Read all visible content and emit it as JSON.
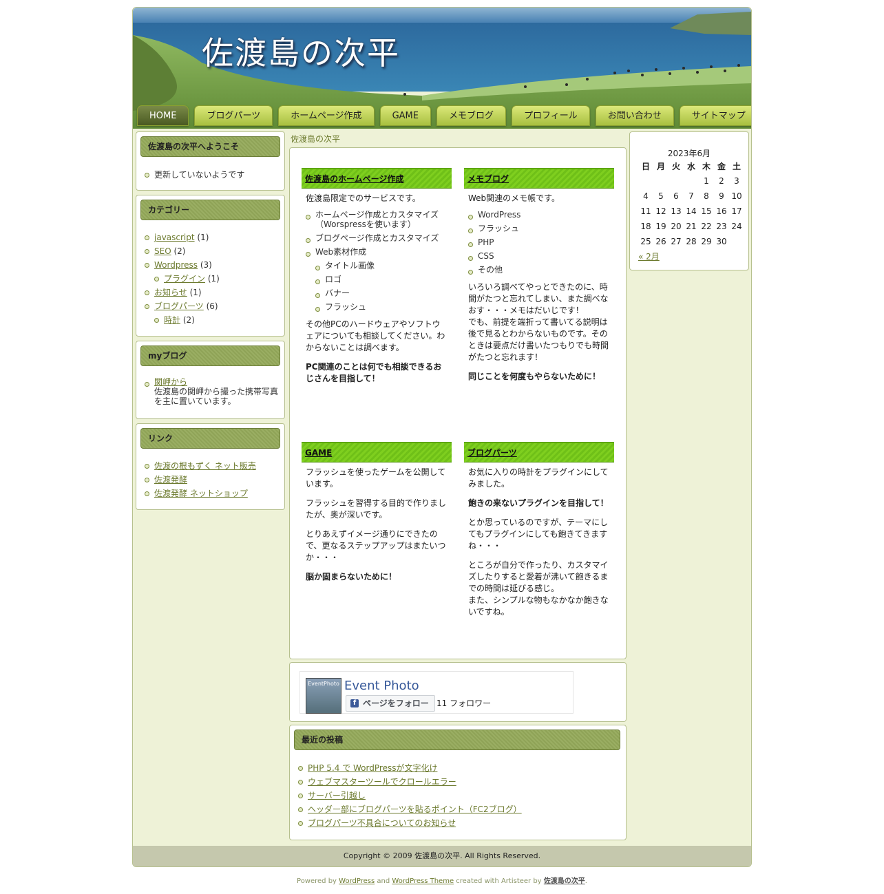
{
  "header": {
    "site_title": "佐渡島の次平"
  },
  "nav": [
    "HOME",
    "ブログパーツ",
    "ホームページ作成",
    "GAME",
    "メモブログ",
    "プロフィール",
    "お問い合わせ",
    "サイトマップ"
  ],
  "sidebar": {
    "welcome": {
      "title": "佐渡島の次平へようこそ",
      "items": [
        "更新していないようです"
      ]
    },
    "categories": {
      "title": "カテゴリー",
      "items": [
        {
          "label": "javascript",
          "count": "(1)",
          "level": 0
        },
        {
          "label": "SEO",
          "count": "(2)",
          "level": 0
        },
        {
          "label": "Wordpress",
          "count": "(3)",
          "level": 0
        },
        {
          "label": "プラグイン",
          "count": "(1)",
          "level": 1
        },
        {
          "label": "お知らせ",
          "count": "(1)",
          "level": 0
        },
        {
          "label": "ブログパーツ",
          "count": "(6)",
          "level": 0
        },
        {
          "label": "時計",
          "count": "(2)",
          "level": 1
        }
      ]
    },
    "myblog": {
      "title": "myブログ",
      "link": "関岬から",
      "desc": "佐渡島の関岬から撮った携帯写真を主に置いています。"
    },
    "links": {
      "title": "リンク",
      "items": [
        "佐渡の根もずく ネット販売",
        "佐渡発酵",
        "佐渡発酵 ネットショップ"
      ]
    }
  },
  "main": {
    "breadcrumb": "佐渡島の次平",
    "sections": [
      {
        "title": "佐渡島のホームページ作成",
        "intro": "佐渡島限定でのサービスです。",
        "list": [
          {
            "t": "ホームページ作成とカスタマイズ（Worspressを使います）",
            "l": 0
          },
          {
            "t": "ブログページ作成とカスタマイズ",
            "l": 0
          },
          {
            "t": "Web素材作成",
            "l": 0
          },
          {
            "t": "タイトル画像",
            "l": 1
          },
          {
            "t": "ロゴ",
            "l": 1
          },
          {
            "t": "バナー",
            "l": 1
          },
          {
            "t": "フラッシュ",
            "l": 1
          }
        ],
        "after": "その他PCのハードウェアやソフトウェアについても相談してください。わからないことは調べます。",
        "bold": "PC関連のことは何でも相談できるおじさんを目指して！"
      },
      {
        "title": "メモブログ",
        "intro": "Web関連のメモ帳です。",
        "list": [
          {
            "t": "WordPress",
            "l": 0
          },
          {
            "t": "フラッシュ",
            "l": 0
          },
          {
            "t": "PHP",
            "l": 0
          },
          {
            "t": "CSS",
            "l": 0
          },
          {
            "t": "その他",
            "l": 0
          }
        ],
        "after": "いろいろ調べてやっとできたのに、時間がたつと忘れてしまい、また調べなおす・・・メモはだいじです！\nでも、前提を端折って書いてる説明は後で見るとわからないものです。そのときは要点だけ書いたつもりでも時間がたつと忘れます！",
        "bold": "同じことを何度もやらないために！"
      },
      {
        "title": "GAME",
        "paras": [
          "フラッシュを使ったゲームを公開しています。",
          "フラッシュを習得する目的で作りましたが、奥が深いです。",
          "とりあえずイメージ通りにできたので、更なるステップアップはまたいつか・・・"
        ],
        "bold": "脳か固まらないために！"
      },
      {
        "title": "ブログパーツ",
        "paras": [
          "お気に入りの時計をプラグインにしてみました。"
        ],
        "bold": "飽きの来ないプラグインを目指して！",
        "paras2": [
          "とか思っているのですが、テーマにしてもプラグインにしても飽きてきますね・・・",
          "ところが自分で作ったり、カスタマイズしたりすると愛着が沸いて飽きるまでの時間は延びる感じ。\nまた、シンプルな物もなかなか飽きないですね。"
        ]
      }
    ],
    "fb": {
      "thumb_label": "EventPhoto",
      "name": "Event Photo",
      "follow_label": "ページをフォロー",
      "followers": "11 フォロワー"
    },
    "recent": {
      "title": "最近の投稿",
      "items": [
        "PHP 5.4 で WordPressが文字化け",
        "ウェブマスターツールでクロールエラー",
        "サーバー引越し",
        "ヘッダー部にブログパーツを貼るポイント（FC2ブログ）",
        "ブログパーツ不具合についてのお知らせ"
      ]
    }
  },
  "calendar": {
    "caption": "2023年6月",
    "days": [
      "日",
      "月",
      "火",
      "水",
      "木",
      "金",
      "土"
    ],
    "weeks": [
      [
        "",
        "",
        "",
        "",
        "1",
        "2",
        "3"
      ],
      [
        "4",
        "5",
        "6",
        "7",
        "8",
        "9",
        "10"
      ],
      [
        "11",
        "12",
        "13",
        "14",
        "15",
        "16",
        "17"
      ],
      [
        "18",
        "19",
        "20",
        "21",
        "22",
        "23",
        "24"
      ],
      [
        "25",
        "26",
        "27",
        "28",
        "29",
        "30",
        ""
      ]
    ],
    "prev": "« 2月"
  },
  "footer": {
    "copyright": "Copyright © 2009 佐渡島の次平. All Rights Reserved.",
    "powered_by": "Powered by",
    "wordpress": "WordPress",
    "and": "and",
    "theme": "WordPress Theme",
    "created": "created with Artisteer by",
    "site": "佐渡島の次平",
    "end": "."
  },
  "colors": {
    "accent": "#7fcf1f",
    "nav_active": "#4a5a22",
    "link": "#6c7a2e"
  }
}
